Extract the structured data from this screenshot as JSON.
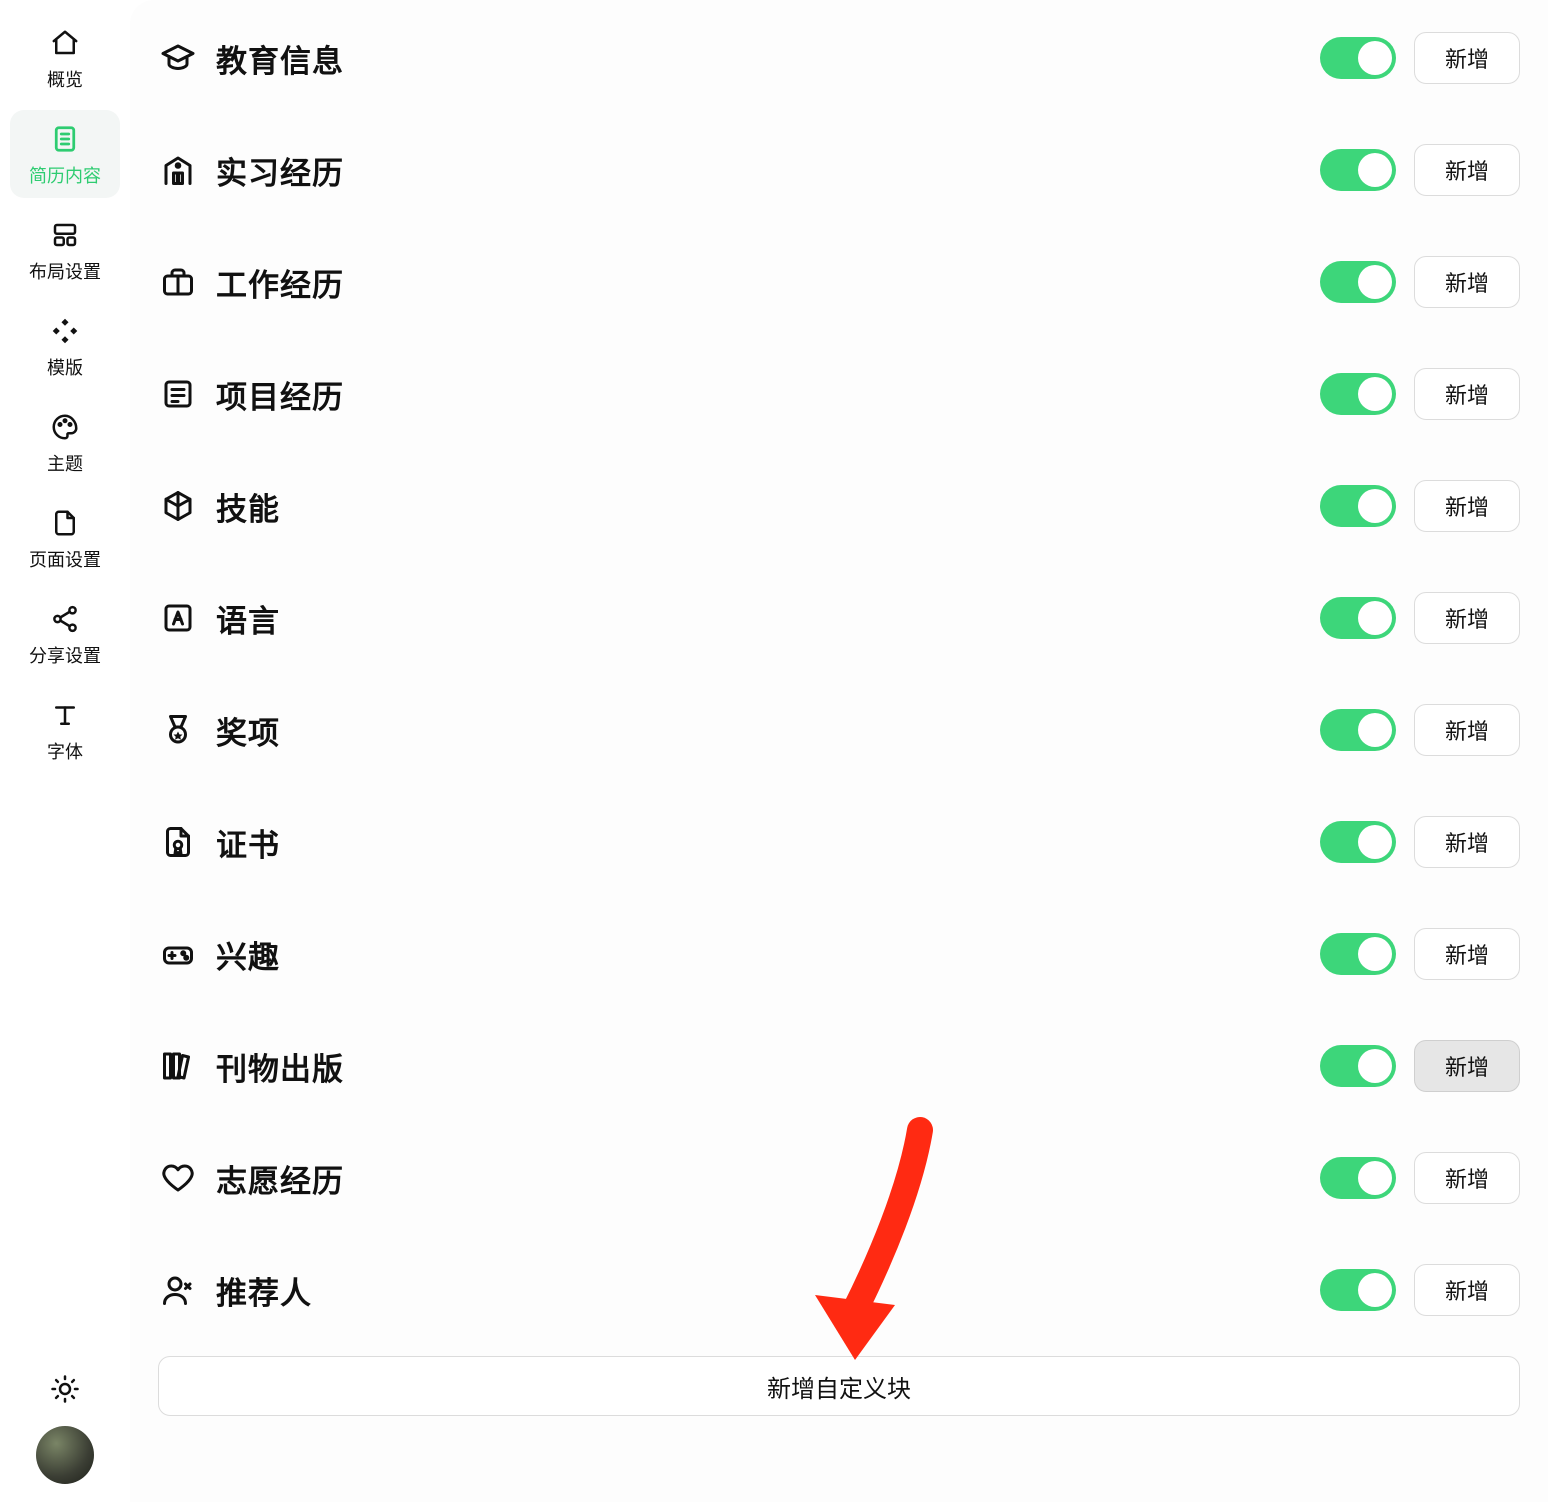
{
  "sidebar": {
    "items": [
      {
        "label": "概览",
        "icon": "home"
      },
      {
        "label": "简历内容",
        "icon": "file-text",
        "active": true
      },
      {
        "label": "布局设置",
        "icon": "layout"
      },
      {
        "label": "模版",
        "icon": "templates"
      },
      {
        "label": "主题",
        "icon": "palette"
      },
      {
        "label": "页面设置",
        "icon": "page"
      },
      {
        "label": "分享设置",
        "icon": "share"
      },
      {
        "label": "字体",
        "icon": "type"
      }
    ],
    "theme_toggle_icon": "sun",
    "avatar": "user-avatar"
  },
  "sections": [
    {
      "title": "教育信息",
      "icon": "graduation",
      "enabled": true,
      "add_label": "新增"
    },
    {
      "title": "实习经历",
      "icon": "building",
      "enabled": true,
      "add_label": "新增"
    },
    {
      "title": "工作经历",
      "icon": "briefcase",
      "enabled": true,
      "add_label": "新增"
    },
    {
      "title": "项目经历",
      "icon": "project",
      "enabled": true,
      "add_label": "新增"
    },
    {
      "title": "技能",
      "icon": "cube",
      "enabled": true,
      "add_label": "新增"
    },
    {
      "title": "语言",
      "icon": "language",
      "enabled": true,
      "add_label": "新增"
    },
    {
      "title": "奖项",
      "icon": "medal",
      "enabled": true,
      "add_label": "新增"
    },
    {
      "title": "证书",
      "icon": "certificate",
      "enabled": true,
      "add_label": "新增"
    },
    {
      "title": "兴趣",
      "icon": "gamepad",
      "enabled": true,
      "add_label": "新增"
    },
    {
      "title": "刊物出版",
      "icon": "books",
      "enabled": true,
      "add_label": "新增",
      "hover": true
    },
    {
      "title": "志愿经历",
      "icon": "heart",
      "enabled": true,
      "add_label": "新增"
    },
    {
      "title": "推荐人",
      "icon": "person",
      "enabled": true,
      "add_label": "新增"
    }
  ],
  "custom_section_button": "新增自定义块",
  "colors": {
    "accent": "#2ecc71",
    "toggle_on": "#3dd67a",
    "annotation": "#ff2a12"
  }
}
